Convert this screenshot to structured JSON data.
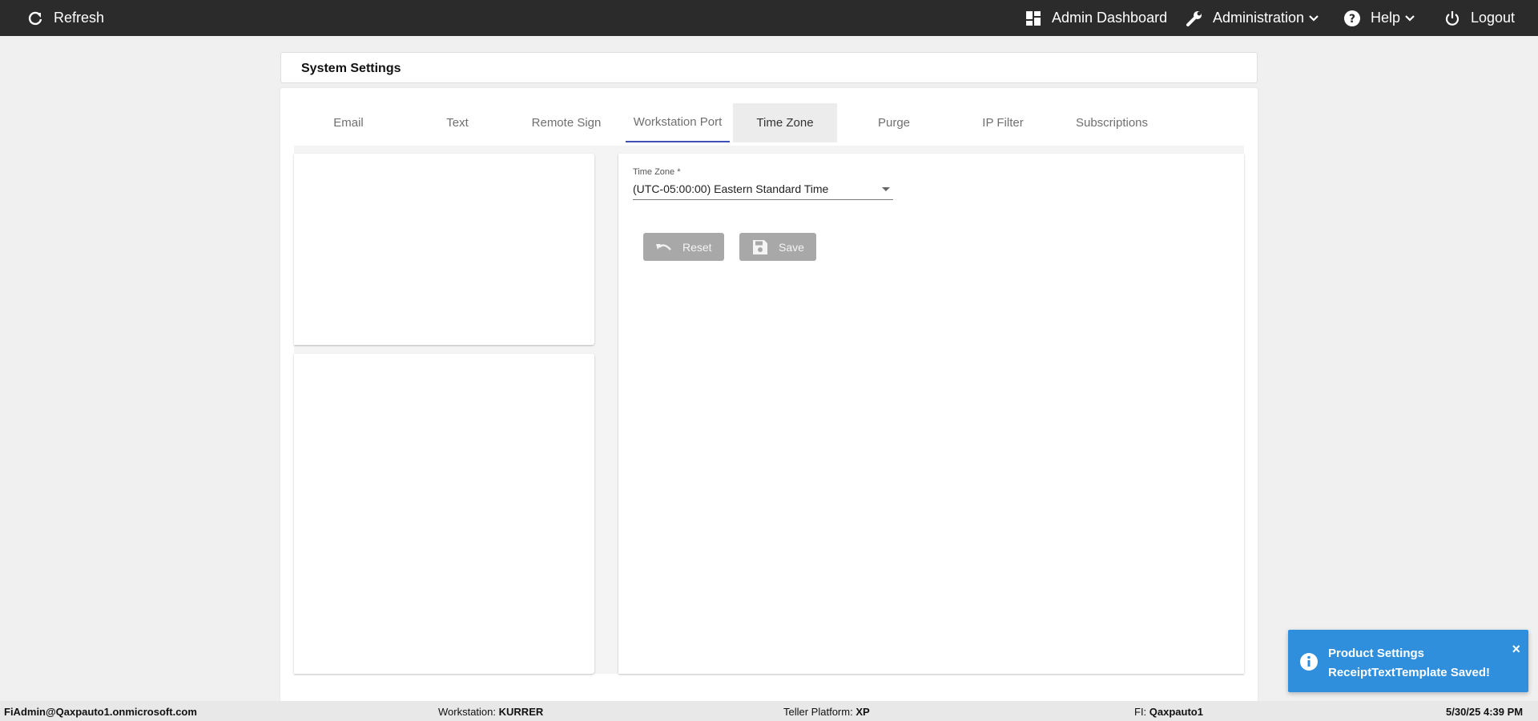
{
  "topbar": {
    "refresh_label": "Refresh",
    "admin_dashboard_label": "Admin Dashboard",
    "administration_label": "Administration",
    "help_label": "Help",
    "logout_label": "Logout"
  },
  "page": {
    "title": "System Settings"
  },
  "tabs": [
    {
      "label": "Email"
    },
    {
      "label": "Text"
    },
    {
      "label": "Remote Sign"
    },
    {
      "label": "Workstation Port"
    },
    {
      "label": "Time Zone"
    },
    {
      "label": "Purge"
    },
    {
      "label": "IP Filter"
    },
    {
      "label": "Subscriptions"
    }
  ],
  "time_zone": {
    "label": "Time Zone *",
    "value": "(UTC-05:00:00) Eastern Standard Time"
  },
  "buttons": {
    "reset_label": "Reset",
    "save_label": "Save"
  },
  "footer": {
    "user": "FiAdmin@Qaxpauto1.onmicrosoft.com",
    "workstation_label": "Workstation:",
    "workstation_value": "KURRER",
    "platform_label": "Teller Platform:",
    "platform_value": "XP",
    "fi_label": "FI:",
    "fi_value": "Qaxpauto1",
    "datetime": "5/30/25 4:39 PM"
  },
  "toast": {
    "line1": "Product Settings",
    "line2": "ReceiptTextTemplate Saved!",
    "close": "×"
  },
  "colors": {
    "topbar": "#2b2b2b",
    "active_tab_underline": "#3f51b5",
    "toast_bg": "#2f8fdd",
    "button_disabled": "#a8a8a8"
  }
}
